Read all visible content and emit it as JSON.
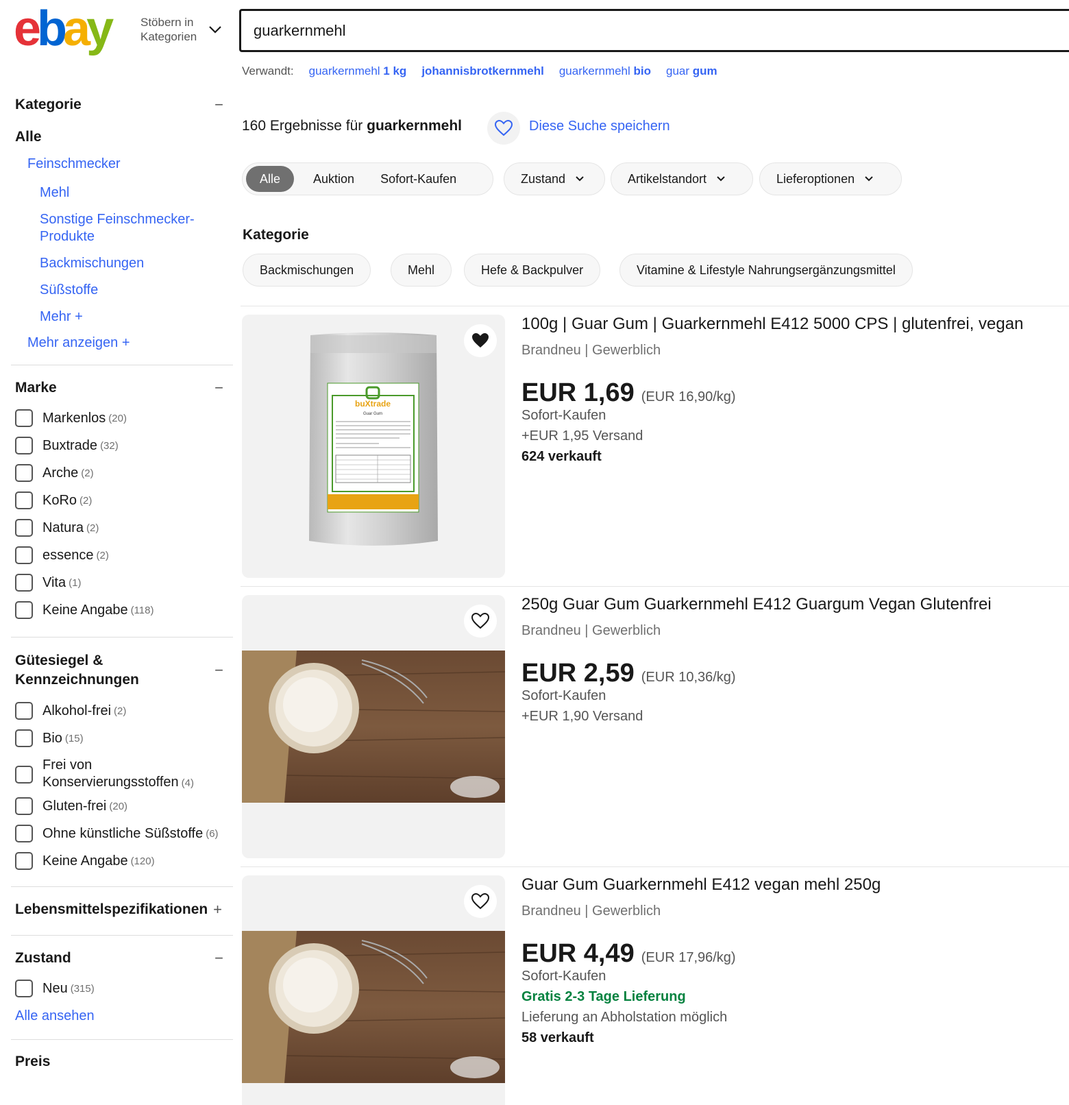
{
  "header": {
    "logo_text": "ebay",
    "browse_label_line1": "Stöbern in",
    "browse_label_line2": "Kategorien",
    "search_value": "guarkernmehl"
  },
  "related": {
    "label": "Verwandt:",
    "items": [
      {
        "pre": "guarkernmehl ",
        "bold": "1 kg"
      },
      {
        "pre": "",
        "bold": "johannisbrotkernmehl"
      },
      {
        "pre": "guarkernmehl ",
        "bold": "bio"
      },
      {
        "pre": "guar ",
        "bold": "gum"
      }
    ]
  },
  "sidebar": {
    "kategorie": {
      "title": "Kategorie",
      "toggle": "−",
      "all": "Alle",
      "level1": "Feinschmecker",
      "items": [
        "Mehl",
        "Sonstige Feinschmecker-Produkte",
        "Backmischungen",
        "Süßstoffe",
        "Mehr +"
      ],
      "more": "Mehr anzeigen +"
    },
    "marke": {
      "title": "Marke",
      "toggle": "−",
      "options": [
        {
          "label": "Markenlos",
          "count": "(20)"
        },
        {
          "label": "Buxtrade",
          "count": "(32)"
        },
        {
          "label": "Arche",
          "count": "(2)"
        },
        {
          "label": "KoRo",
          "count": "(2)"
        },
        {
          "label": "Natura",
          "count": "(2)"
        },
        {
          "label": "essence",
          "count": "(2)"
        },
        {
          "label": "Vita",
          "count": "(1)"
        },
        {
          "label": "Keine Angabe",
          "count": "(118)"
        }
      ]
    },
    "guetesiegel": {
      "title_line1": "Gütesiegel &",
      "title_line2": "Kennzeichnungen",
      "toggle": "−",
      "options": [
        {
          "label": "Alkohol-frei",
          "count": "(2)"
        },
        {
          "label": "Bio",
          "count": "(15)"
        },
        {
          "label": "Frei von",
          "label2": "Konservierungsstoffen",
          "count": "(4)"
        },
        {
          "label": "Gluten-frei",
          "count": "(20)"
        },
        {
          "label": "Ohne künstliche Süßstoffe",
          "count": "(6)"
        },
        {
          "label": "Keine Angabe",
          "count": "(120)"
        }
      ]
    },
    "lebensmittel": {
      "title": "Lebensmittelspezifikationen",
      "toggle": "+"
    },
    "zustand": {
      "title": "Zustand",
      "toggle": "−",
      "options": [
        {
          "label": "Neu",
          "count": "(315)"
        }
      ],
      "see_all": "Alle ansehen"
    },
    "preis": {
      "title": "Preis"
    }
  },
  "results": {
    "count": "160",
    "text_mid": " Ergebnisse für ",
    "query": "guarkernmehl",
    "save_search": "Diese Suche speichern"
  },
  "filters": {
    "buying_format": [
      "Alle",
      "Auktion",
      "Sofort-Kaufen"
    ],
    "dropdowns": [
      "Zustand",
      "Artikelstandort",
      "Lieferoptionen"
    ]
  },
  "category_pills": {
    "title": "Kategorie",
    "items": [
      "Backmischungen",
      "Mehl",
      "Hefe & Backpulver",
      "Vitamine & Lifestyle Nahrungsergänzungsmittel"
    ]
  },
  "items": [
    {
      "title": "100g | Guar Gum | Guarkernmehl E412 5000 CPS | glutenfrei, vegan",
      "subtitle": "Brandneu | Gewerblich",
      "price": "EUR 1,69",
      "unit_price": "(EUR 16,90/kg)",
      "format": "Sofort-Kaufen",
      "shipping": "+EUR 1,95 Versand",
      "sold": "624 verkauft",
      "watched": true,
      "image_label": "buXtrade",
      "image_sublabel": "Guar Gum"
    },
    {
      "title": "250g Guar Gum Guarkernmehl E412 Guargum Vegan Glutenfrei",
      "subtitle": "Brandneu | Gewerblich",
      "price": "EUR 2,59",
      "unit_price": "(EUR 10,36/kg)",
      "format": "Sofort-Kaufen",
      "shipping": "+EUR 1,90 Versand",
      "watched": false
    },
    {
      "title": "Guar Gum Guarkernmehl E412 vegan mehl 250g",
      "subtitle": "Brandneu | Gewerblich",
      "price": "EUR 4,49",
      "unit_price": "(EUR 17,96/kg)",
      "format": "Sofort-Kaufen",
      "delivery": "Gratis 2-3 Tage Lieferung",
      "pickup": "Lieferung an Abholstation möglich",
      "sold": "58 verkauft",
      "watched": false
    }
  ],
  "colors": {
    "link": "#3665f3",
    "green": "#05823f",
    "logo_red": "#e53238",
    "logo_blue": "#0064d2",
    "logo_yellow": "#f5af02",
    "logo_green": "#86b817"
  }
}
